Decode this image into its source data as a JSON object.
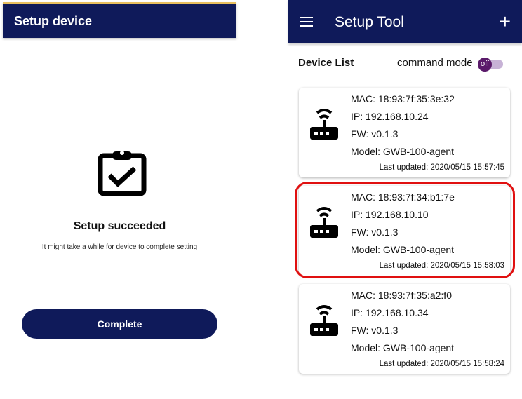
{
  "setup": {
    "title": "Setup device",
    "status": "Setup succeeded",
    "note": "It might take a while for device to complete setting",
    "complete_label": "Complete"
  },
  "tool": {
    "title": "Setup Tool",
    "list_label": "Device List",
    "command_mode_label": "command mode",
    "toggle_state": "off",
    "devices": [
      {
        "mac": "MAC: 18:93:7f:35:3e:32",
        "ip": "IP: 192.168.10.24",
        "fw": "FW: v0.1.3",
        "model": "Model: GWB-100-agent",
        "updated": "Last updated: 2020/05/15 15:57:45"
      },
      {
        "mac": "MAC: 18:93:7f:34:b1:7e",
        "ip": "IP: 192.168.10.10",
        "fw": "FW: v0.1.3",
        "model": "Model: GWB-100-agent",
        "updated": "Last updated: 2020/05/15 15:58:03"
      },
      {
        "mac": "MAC: 18:93:7f:35:a2:f0",
        "ip": "IP: 192.168.10.34",
        "fw": "FW: v0.1.3",
        "model": "Model: GWB-100-agent",
        "updated": "Last updated: 2020/05/15 15:58:24"
      }
    ]
  },
  "colors": {
    "header": "#0f1a5a",
    "highlight": "#e01010"
  }
}
